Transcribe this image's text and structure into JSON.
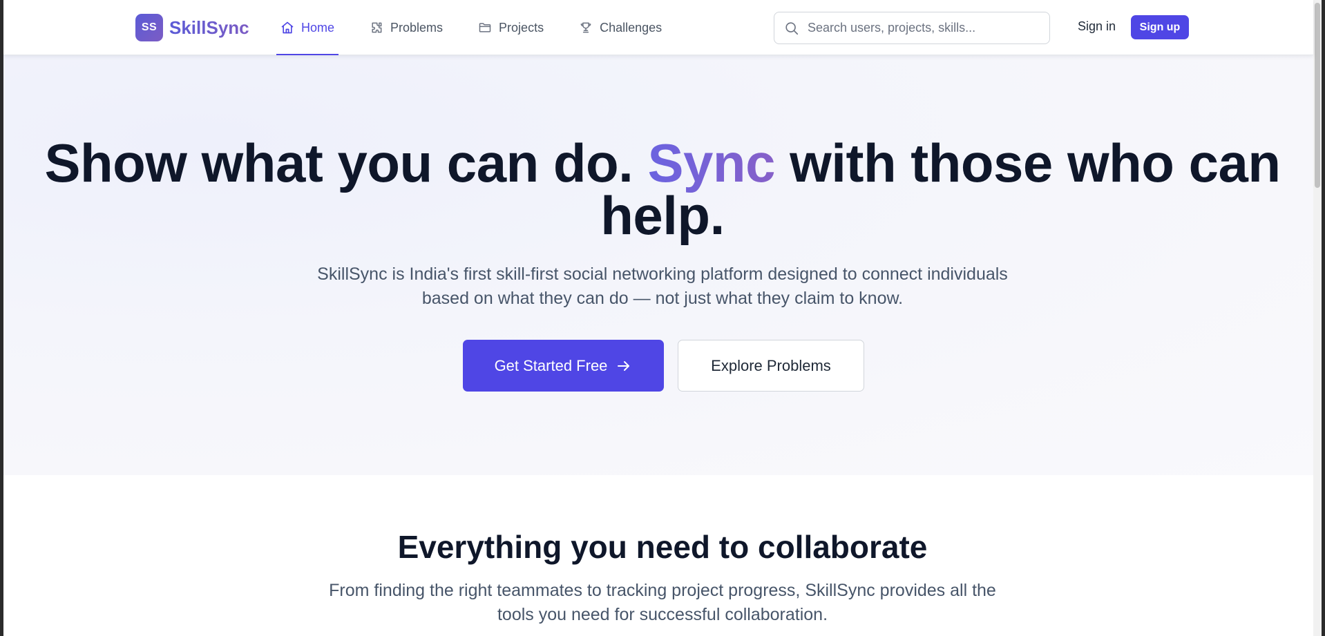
{
  "brand": {
    "logo_initials": "SS",
    "name": "SkillSync"
  },
  "nav": {
    "items": [
      {
        "label": "Home",
        "icon": "home-icon",
        "active": true
      },
      {
        "label": "Problems",
        "icon": "puzzle-icon",
        "active": false
      },
      {
        "label": "Projects",
        "icon": "folder-icon",
        "active": false
      },
      {
        "label": "Challenges",
        "icon": "trophy-icon",
        "active": false
      }
    ]
  },
  "search": {
    "placeholder": "Search users, projects, skills...",
    "value": ""
  },
  "auth": {
    "signin_label": "Sign in",
    "signup_label": "Sign up"
  },
  "hero": {
    "title_part1": "Show what you can do. ",
    "title_accent": "Sync",
    "title_part2": " with those who can help.",
    "subtitle": "SkillSync is India's first skill-first social networking platform designed to connect individuals based on what they can do — not just what they claim to know.",
    "primary_button": "Get Started Free",
    "secondary_button": "Explore Problems"
  },
  "features": {
    "title": "Everything you need to collaborate",
    "subtitle": "From finding the right teammates to tracking project progress, SkillSync provides all the tools you need for successful collaboration."
  },
  "colors": {
    "accent": "#4f46e5",
    "brand_gradient_start": "#5b5bd6",
    "brand_gradient_end": "#7c5cc4"
  }
}
